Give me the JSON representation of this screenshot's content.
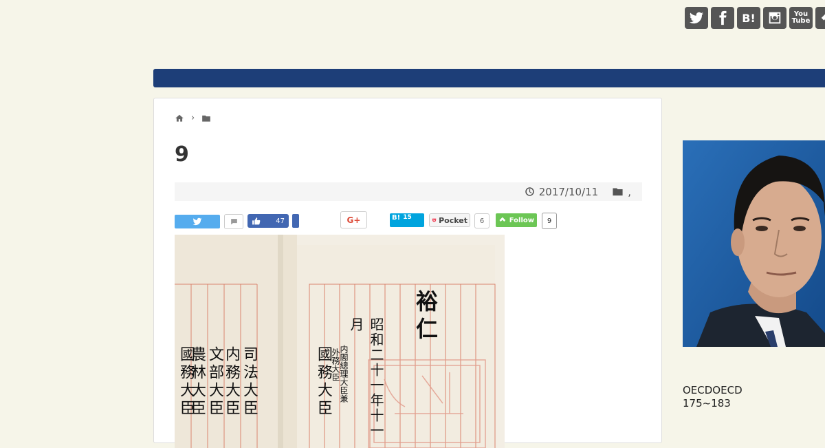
{
  "social": {
    "icons": [
      "twitter-icon",
      "facebook-icon",
      "hatena-bookmark-icon",
      "instagram-icon",
      "youtube-icon",
      "feedly-icon"
    ],
    "hatena_label": "B!",
    "youtube_label_top": "You",
    "youtube_label_bottom": "Tube"
  },
  "colors": {
    "background": "#f6f5e9",
    "navbar": "#1d3e78",
    "twitter": "#55acee",
    "facebook": "#4267b2",
    "hatena": "#00a4de",
    "feedly": "#6cc655",
    "google_plus": "#dd4b39"
  },
  "breadcrumb": {
    "separator": "›"
  },
  "article": {
    "title": "9",
    "date": "2017/10/11",
    "category_sep": ","
  },
  "share": {
    "facebook_count": "47",
    "google_plus_label": "G+",
    "hatena_label": "B!",
    "hatena_count": "15",
    "pocket_label": "Pocket",
    "pocket_count": "6",
    "feedly_label": "Follow",
    "feedly_count": "9"
  },
  "document_image": {
    "left_page_columns": [
      "國務大臣",
      "農林大臣",
      "文部大臣",
      "内務大臣",
      "司法大臣"
    ],
    "right_page_signature": "裕仁",
    "right_page_date": "昭和二十一年十一月",
    "right_page_small_1": "内閣總理大臣兼",
    "right_page_small_2": "外務大臣",
    "right_page_minister": "國務大臣"
  },
  "sidebar": {
    "text_line1": "OECDOECD",
    "text_line2": "175~183"
  }
}
